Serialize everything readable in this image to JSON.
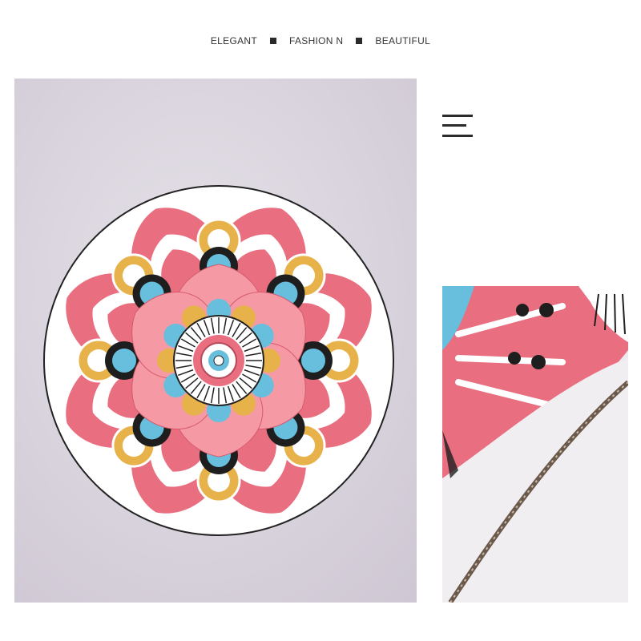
{
  "tagline": {
    "word1": "ELEGANT",
    "word2": "FASHION N",
    "word3": "BEAUTIFUL"
  },
  "icons": {
    "menu": "menu-icon"
  },
  "colors": {
    "background": "#ffffff",
    "mat_pink": "#e96f80",
    "mat_blue": "#67bedd",
    "mat_yellow": "#e7b24a",
    "surface": "#d9d3de"
  }
}
